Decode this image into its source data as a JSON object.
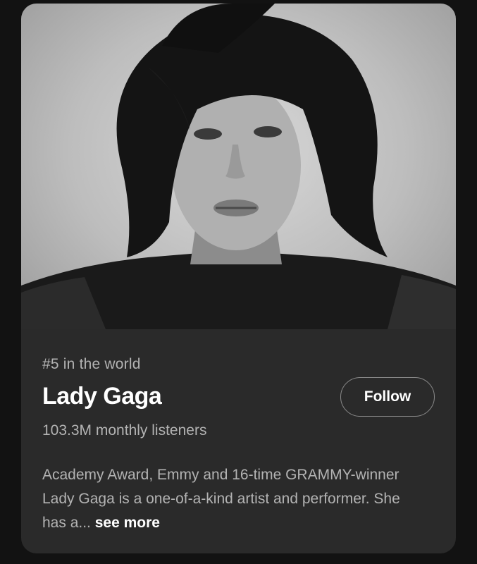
{
  "artist_card": {
    "photo_alt": "Lady Gaga",
    "rank": "#5 in the world",
    "name": "Lady Gaga",
    "listeners": "103.3M monthly listeners",
    "follow_label": "Follow",
    "bio_text": "Academy Award, Emmy and 16-time GRAMMY-winner Lady Gaga is a one-of-a-kind artist and performer. She has a...",
    "see_more_label": "see more"
  },
  "colors": {
    "background": "#121212",
    "card": "#2a2a2a",
    "text_primary": "#ffffff",
    "text_secondary": "#b3b3b3"
  }
}
